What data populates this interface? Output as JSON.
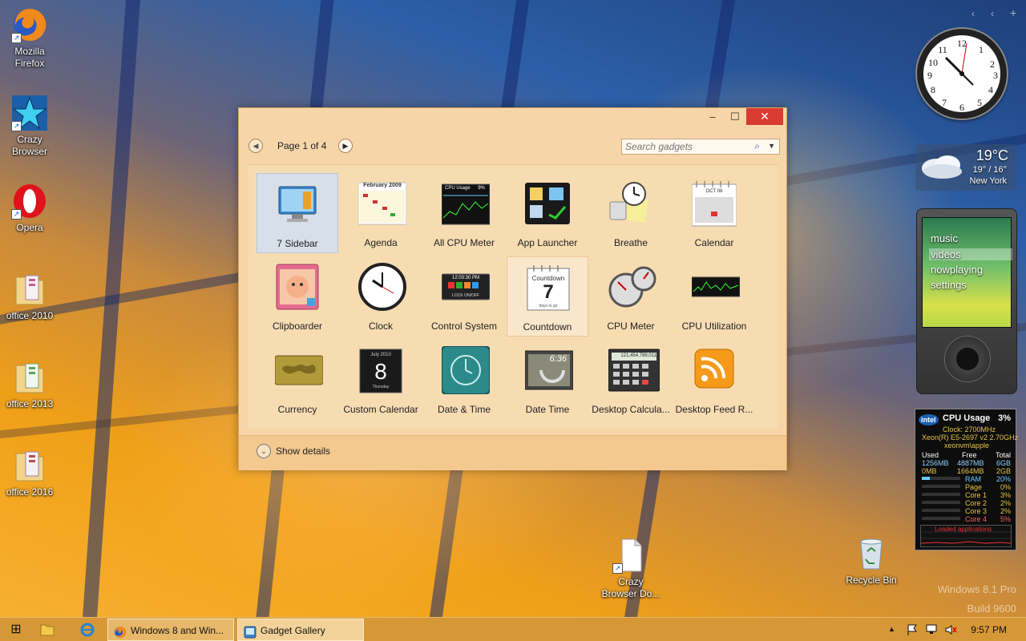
{
  "desktop": {
    "icons": [
      {
        "label_line1": "Mozilla",
        "label_line2": "Firefox"
      },
      {
        "label_line1": "Crazy",
        "label_line2": "Browser"
      },
      {
        "label_line1": "Opera",
        "label_line2": ""
      },
      {
        "label_line1": "office 2010",
        "label_line2": ""
      },
      {
        "label_line1": "office 2013",
        "label_line2": ""
      },
      {
        "label_line1": "office 2016",
        "label_line2": ""
      },
      {
        "label_line1": "Crazy",
        "label_line2": "Browser Do..."
      },
      {
        "label_line1": "Recycle Bin",
        "label_line2": ""
      }
    ],
    "watermark": {
      "line1": "Windows 8.1 Pro",
      "line2": "Build 9600"
    }
  },
  "window": {
    "title": "Gadget Gallery",
    "minimize_symbol": "–",
    "maximize_symbol": "☐",
    "close_symbol": "✕",
    "page_label": "Page 1 of 4",
    "prev_symbol": "◀",
    "next_symbol": "▶",
    "search_placeholder": "Search gadgets",
    "search_symbol": "⌕",
    "search_dropdown_symbol": "▼",
    "gadgets": [
      {
        "label": "7 Sidebar",
        "icon": "monitor-icon"
      },
      {
        "label": "Agenda",
        "icon": "calendar-grid-icon"
      },
      {
        "label": "All CPU Meter",
        "icon": "cpu-graph-icon"
      },
      {
        "label": "App Launcher",
        "icon": "app-launcher-icon"
      },
      {
        "label": "Breathe",
        "icon": "breathe-icon"
      },
      {
        "label": "Calendar",
        "icon": "calendar-icon"
      },
      {
        "label": "Clipboarder",
        "icon": "clipboarder-icon"
      },
      {
        "label": "Clock",
        "icon": "clock-icon"
      },
      {
        "label": "Control System",
        "icon": "control-system-icon"
      },
      {
        "label": "Countdown",
        "icon": "countdown-icon"
      },
      {
        "label": "CPU Meter",
        "icon": "cpu-meter-icon"
      },
      {
        "label": "CPU Utilization",
        "icon": "cpu-utilization-icon"
      },
      {
        "label": "Currency",
        "icon": "currency-icon"
      },
      {
        "label": "Custom Calendar",
        "icon": "custom-calendar-icon"
      },
      {
        "label": "Date & Time",
        "icon": "date-time-clock-icon"
      },
      {
        "label": "Date Time",
        "icon": "date-time-icon"
      },
      {
        "label": "Desktop Calcula...",
        "icon": "calculator-icon"
      },
      {
        "label": "Desktop Feed R...",
        "icon": "rss-feed-icon"
      }
    ],
    "gadget_texts": {
      "agenda_month": "February 2009",
      "cpu_usage_title": "CPU Usage",
      "cpu_usage_pct": "9%",
      "control_time": "12:03:30 PM",
      "control_lock": "LOCK ON/OFF",
      "countdown_title": "Countdown",
      "countdown_num": "7",
      "countdown_sub": "days to go",
      "custom_cal_month": "July 2010",
      "custom_cal_day": "8",
      "custom_cal_weekday": "Thursday",
      "datetime_digits": "6:36",
      "calc_display": "121,454,789,011",
      "calendar_month": "OCT 06"
    },
    "show_details_label": "Show details",
    "show_details_symbol": "⌄"
  },
  "sidebar": {
    "weather": {
      "temp": "19°C",
      "range": "19° / 16°",
      "city": "New York"
    },
    "zune_menu": [
      "music",
      "videos",
      "nowplaying",
      "settings"
    ],
    "cpu": {
      "title": "CPU Usage",
      "pct": "3%",
      "clock": "Clock: 2700MHz",
      "model": "Xeon(R) E5-2697 v2 2.70GHz",
      "host": "xeonvm\\apple",
      "headers": [
        "Used",
        "Free",
        "Total"
      ],
      "mem_rows": [
        [
          "1256MB",
          "4887MB",
          "6GB"
        ],
        [
          "0MB",
          "1664MB",
          "2GB"
        ]
      ],
      "meters": [
        {
          "name": "RAM",
          "value": "20%"
        },
        {
          "name": "Page",
          "value": "0%"
        },
        {
          "name": "Core 1",
          "value": "3%"
        },
        {
          "name": "Core 2",
          "value": "2%"
        },
        {
          "name": "Core 3",
          "value": "2%"
        },
        {
          "name": "Core 4",
          "value": "5%"
        }
      ],
      "graph_label": "Loaded applications",
      "badge": "intel"
    },
    "controls": {
      "prev": "‹",
      "settings": "‹",
      "add": "+"
    }
  },
  "taskbar": {
    "start_symbol": "⊞",
    "apps": [
      {
        "label": "Windows 8 and Win..."
      },
      {
        "label": "Gadget Gallery"
      }
    ],
    "tray_up": "▲",
    "clock": "9:57 PM"
  }
}
